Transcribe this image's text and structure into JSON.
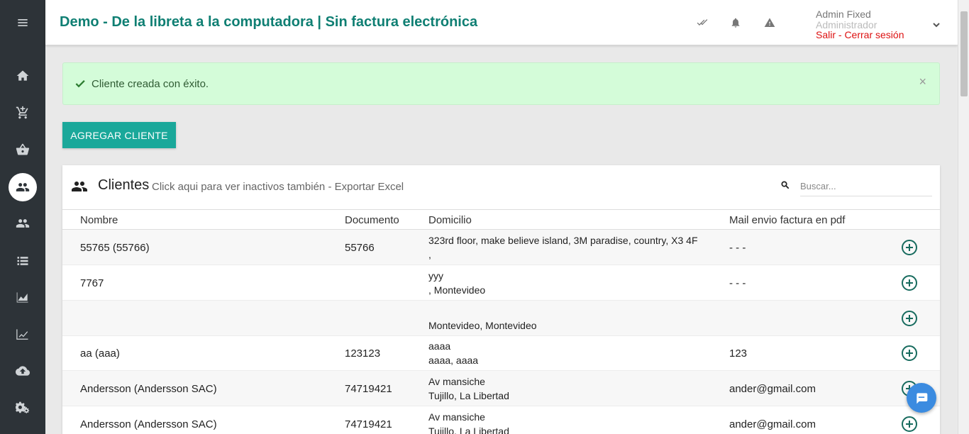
{
  "header": {
    "title": "Demo - De la libreta a la computadora | Sin factura electrónica",
    "user_name": "Admin Fixed",
    "user_role": "Administrador",
    "logout_label": "Salir - Cerrar sesión"
  },
  "sidebar": {
    "items": [
      {
        "icon": "menu-icon"
      },
      {
        "icon": "home-icon"
      },
      {
        "icon": "add-cart-icon"
      },
      {
        "icon": "basket-icon"
      },
      {
        "icon": "clients-icon",
        "active": true
      },
      {
        "icon": "users-icon"
      },
      {
        "icon": "list-icon"
      },
      {
        "icon": "area-chart-icon"
      },
      {
        "icon": "line-chart-icon"
      },
      {
        "icon": "cloud-upload-icon"
      },
      {
        "icon": "settings-icon"
      }
    ]
  },
  "alert": {
    "message": "Cliente creada con éxito.",
    "close": "×"
  },
  "actions": {
    "add_client_label": "AGREGAR CLIENTE"
  },
  "card": {
    "title": "Clientes",
    "subtitle": "Click aqui para ver inactivos también - Exportar Excel",
    "search_placeholder": "Buscar..."
  },
  "table": {
    "headers": [
      "Nombre",
      "Documento",
      "Domicilio",
      "Mail envio factura en pdf"
    ],
    "rows": [
      {
        "name": "55765 (55766)",
        "document": "55766",
        "addr1": "323rd floor, make believe island, 3M paradise, country, X3 4F",
        "addr2": ",",
        "mail": "- - -"
      },
      {
        "name": "7767",
        "document": "",
        "addr1": "yyy",
        "addr2": ", Montevideo",
        "mail": "- - -"
      },
      {
        "name": "",
        "document": "",
        "addr1": "",
        "addr2": "Montevideo, Montevideo",
        "mail": ""
      },
      {
        "name": "aa (aaa)",
        "document": "123123",
        "addr1": "aaaa",
        "addr2": "aaaa, aaaa",
        "mail": "123"
      },
      {
        "name": "Andersson (Andersson SAC)",
        "document": "74719421",
        "addr1": "Av mansiche",
        "addr2": "Tujillo, La Libertad",
        "mail": "ander@gmail.com"
      },
      {
        "name": "Andersson (Andersson SAC)",
        "document": "74719421",
        "addr1": "Av mansiche",
        "addr2": "Tujillo, La Libertad",
        "mail": "ander@gmail.com"
      }
    ]
  },
  "colors": {
    "brand": "#0f7f73",
    "button": "#1aa89a",
    "sidebar": "#2d3338",
    "alert_bg": "#d4fcd9",
    "logout": "#dd1111",
    "chat": "#3b8be0"
  }
}
